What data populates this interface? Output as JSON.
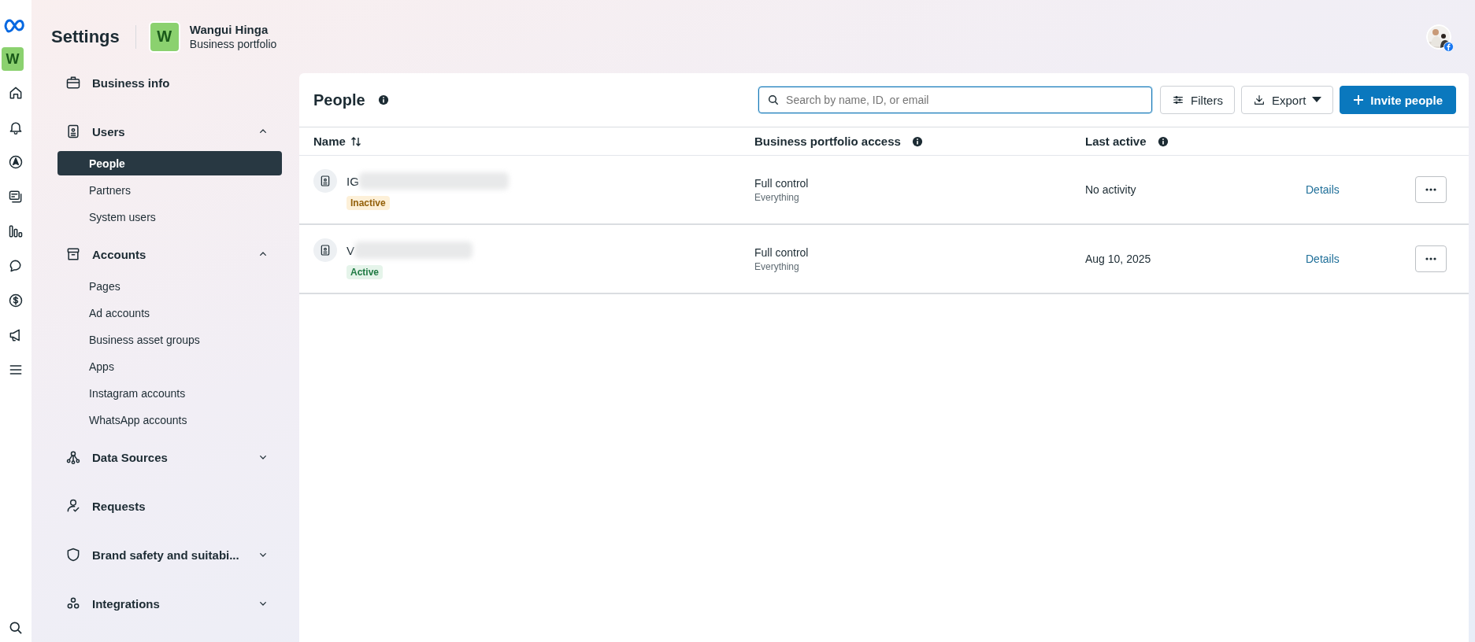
{
  "header": {
    "title": "Settings",
    "portfolio_initial": "W",
    "portfolio_name": "Wangui Hinga",
    "portfolio_subtitle": "Business portfolio"
  },
  "rail": {
    "portfolio_initial": "W",
    "items": [
      {
        "kind": "home"
      },
      {
        "kind": "bell"
      },
      {
        "kind": "compass"
      },
      {
        "kind": "pages"
      },
      {
        "kind": "chart"
      },
      {
        "kind": "chat"
      },
      {
        "kind": "dollar"
      },
      {
        "kind": "megaphone"
      },
      {
        "kind": "menu"
      }
    ]
  },
  "sidebar": {
    "sections": [
      {
        "label": "Business info",
        "kind": "briefcase"
      },
      {
        "label": "Users",
        "kind": "badge",
        "expanded": true,
        "children": [
          {
            "label": "People",
            "selected": true
          },
          {
            "label": "Partners",
            "selected": false
          },
          {
            "label": "System users",
            "selected": false
          }
        ]
      },
      {
        "label": "Accounts",
        "kind": "archive",
        "expanded": true,
        "children": [
          {
            "label": "Pages",
            "selected": false
          },
          {
            "label": "Ad accounts",
            "selected": false
          },
          {
            "label": "Business asset groups",
            "selected": false
          },
          {
            "label": "Apps",
            "selected": false
          },
          {
            "label": "Instagram accounts",
            "selected": false
          },
          {
            "label": "WhatsApp accounts",
            "selected": false
          }
        ]
      },
      {
        "label": "Data Sources",
        "kind": "nodes",
        "expanded": false
      },
      {
        "label": "Requests",
        "kind": "person"
      },
      {
        "label": "Brand safety and suitabi...",
        "kind": "shield",
        "expanded": false
      },
      {
        "label": "Integrations",
        "kind": "links",
        "expanded": false
      }
    ]
  },
  "panel": {
    "title": "People",
    "search": {
      "placeholder": "Search by name, ID, or email"
    },
    "filters_button": "Filters",
    "export_button": "Export",
    "invite_button": "Invite people",
    "table": {
      "columns": [
        {
          "label": "Name",
          "sortable": true,
          "info": false
        },
        {
          "label": "Business portfolio access",
          "sortable": false,
          "info": true
        },
        {
          "label": "Last active",
          "sortable": false,
          "info": true
        }
      ],
      "rows": [
        {
          "name": "IG",
          "status": {
            "label": "Inactive",
            "kind": "warning"
          },
          "access": "Full control",
          "access_detail": "Everything",
          "last_active": "No activity",
          "link": "Details"
        },
        {
          "name": "V",
          "status": {
            "label": "Active",
            "kind": "success"
          },
          "access": "Full control",
          "access_detail": "Everything",
          "last_active": "Aug 10, 2025",
          "link": "Details"
        }
      ]
    }
  }
}
